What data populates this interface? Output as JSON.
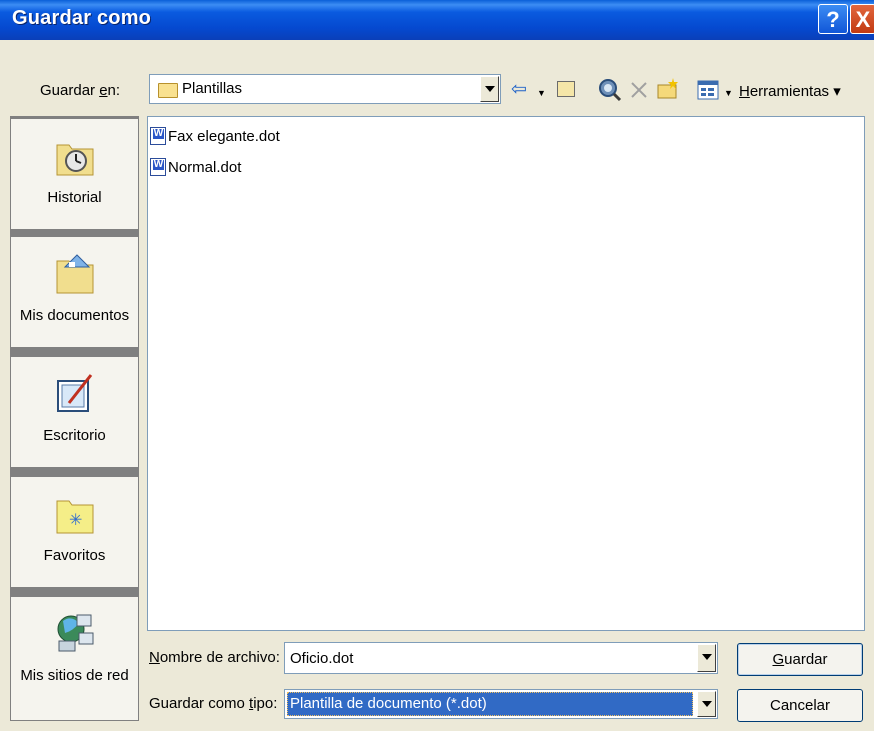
{
  "window": {
    "title": "Guardar como",
    "help_glyph": "?",
    "close_glyph": "X"
  },
  "location": {
    "label_pre": "Guardar ",
    "label_key": "e",
    "label_post": "n:",
    "value": "Plantillas"
  },
  "toolbar": {
    "back_glyph": "⇦",
    "tools_key": "H",
    "tools_rest": "erramientas"
  },
  "places": [
    {
      "label": "Historial",
      "icon": "history-icon"
    },
    {
      "label": "Mis documentos",
      "icon": "my-documents-icon"
    },
    {
      "label": "Escritorio",
      "icon": "desktop-icon"
    },
    {
      "label": "Favoritos",
      "icon": "favorites-icon"
    },
    {
      "label": "Mis sitios de red",
      "icon": "network-places-icon"
    }
  ],
  "files": [
    {
      "name": "Fax elegante.dot",
      "icon": "word-template-icon"
    },
    {
      "name": "Normal.dot",
      "icon": "word-template-icon"
    }
  ],
  "filename": {
    "label_key": "N",
    "label_rest": "ombre de archivo:",
    "value": "Oficio.dot"
  },
  "filetype": {
    "label_pre": "Guardar como ",
    "label_key": "t",
    "label_post": "ipo:",
    "value": "Plantilla de documento (*.dot)"
  },
  "buttons": {
    "save_key": "G",
    "save_rest": "uardar",
    "cancel": "Cancelar"
  },
  "colors": {
    "title_bar": "#0A5BE0",
    "dialog_bg": "#ECE9D8",
    "selection": "#316AC5"
  }
}
